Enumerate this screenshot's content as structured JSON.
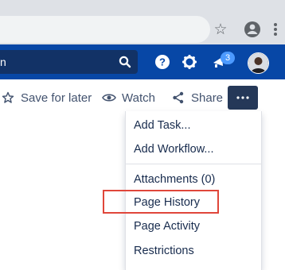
{
  "header": {
    "search_value": "n",
    "notification_count": "3"
  },
  "actions": {
    "save_for_later": "Save for later",
    "watch": "Watch",
    "share": "Share",
    "more": "•••"
  },
  "menu": {
    "items": [
      "Add Task...",
      "Add Workflow...",
      "Attachments (0)",
      "Page History",
      "Page Activity",
      "Restrictions"
    ],
    "highlighted": "Page History"
  },
  "colors": {
    "header_bg": "#0747a6",
    "highlight_border": "#e0463a",
    "more_button_bg": "#253858",
    "badge_bg": "#4c9aff"
  },
  "icons": [
    "star-icon",
    "profile-icon",
    "kebab-menu-icon",
    "search-icon",
    "help-icon",
    "settings-icon",
    "notifications-icon",
    "bookmark-icon",
    "eye-icon",
    "share-icon"
  ]
}
